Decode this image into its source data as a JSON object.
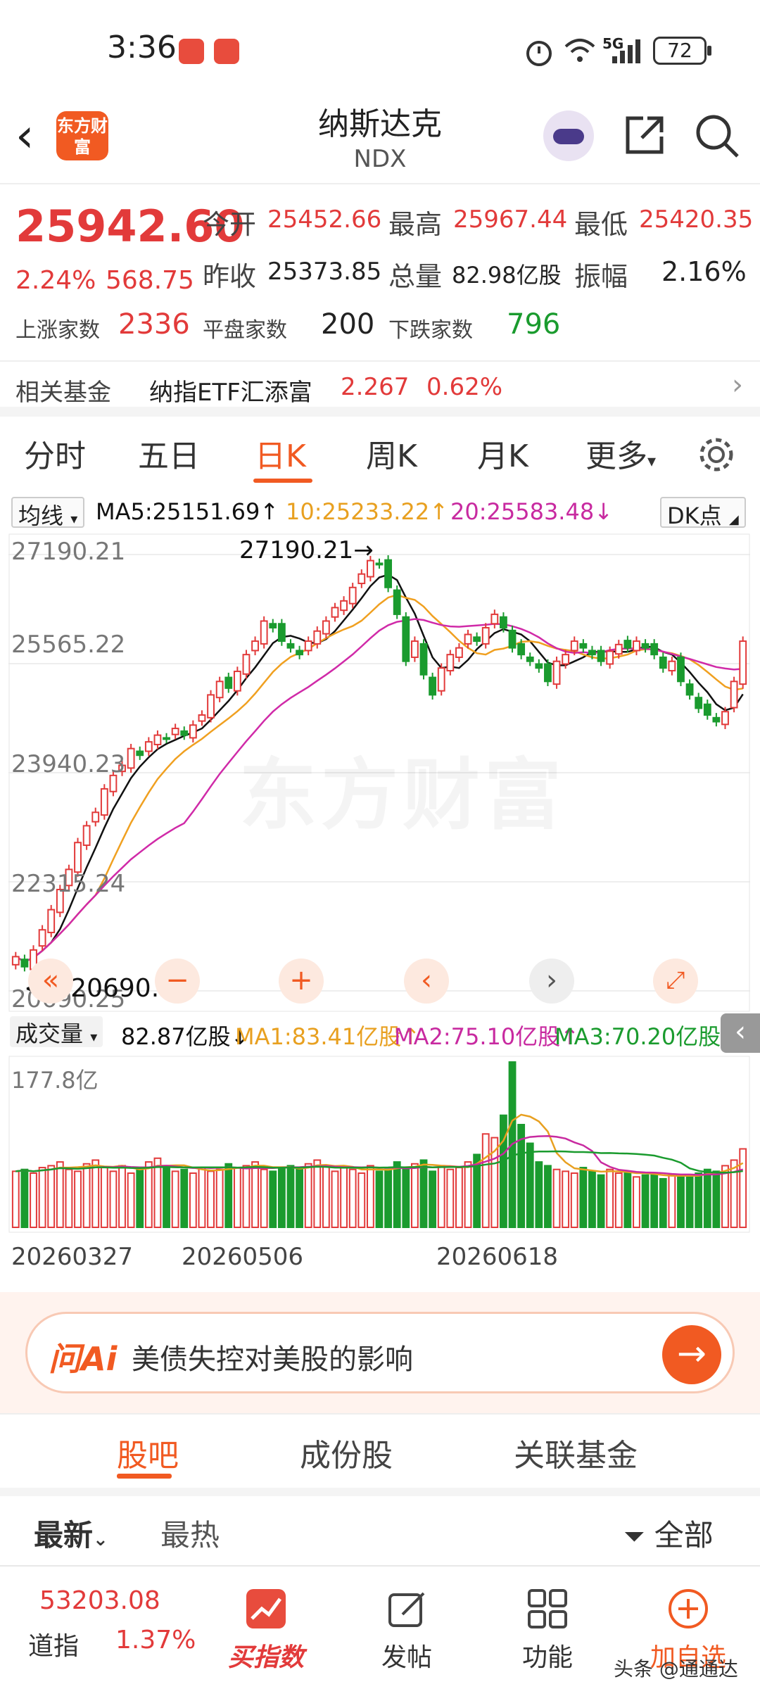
{
  "status_bar": {
    "time": "3:36",
    "network": "5G",
    "battery": "72"
  },
  "header": {
    "title": "纳斯达克",
    "code": "NDX",
    "logo_text": "东方财富"
  },
  "quote": {
    "price": "25942.60",
    "change_pct": "2.24%",
    "change": "568.75",
    "open_label": "今开",
    "open": "25452.66",
    "high_label": "最高",
    "high": "25967.44",
    "low_label": "最低",
    "low": "25420.35",
    "prev_close_label": "昨收",
    "prev_close": "25373.85",
    "volume_label": "总量",
    "volume": "82.98亿股",
    "amplitude_label": "振幅",
    "amplitude": "2.16%",
    "up_label": "上涨家数",
    "up": "2336",
    "flat_label": "平盘家数",
    "flat": "200",
    "down_label": "下跌家数",
    "down": "796"
  },
  "related_fund": {
    "label": "相关基金",
    "name": "纳指ETF汇添富",
    "price": "2.267",
    "change": "0.62%"
  },
  "period_tabs": [
    "分时",
    "五日",
    "日K",
    "周K",
    "月K",
    "更多"
  ],
  "indicators": {
    "selector": "均线",
    "ma5": "MA5:25151.69↑",
    "ma10": "10:25233.22↑",
    "ma20": "20:25583.48↓",
    "dk_button": "DK点"
  },
  "chart_data": {
    "type": "candlestick",
    "y_ticks": [
      "27190.21",
      "25565.22",
      "23940.23",
      "22315.24",
      "20690.25"
    ],
    "ylim": [
      20690.25,
      27190.21
    ],
    "max_marker": "27190.21",
    "min_marker": "20690.25",
    "watermark": "东方财富",
    "x_labels": [
      "20260327",
      "20260506",
      "20260618"
    ],
    "colors": {
      "up": "#e23a3a",
      "down": "#1a9b2e",
      "ma5": "#111111",
      "ma10": "#f0a020",
      "ma20": "#d02aa8"
    },
    "close_series": [
      21200,
      21050,
      21300,
      21600,
      21900,
      22200,
      22500,
      22900,
      23150,
      23350,
      23700,
      23900,
      24050,
      24300,
      24200,
      24400,
      24500,
      24450,
      24600,
      24500,
      24650,
      24800,
      25100,
      25300,
      25200,
      25450,
      25700,
      25900,
      26200,
      26100,
      25900,
      25800,
      25700,
      25900,
      26050,
      26200,
      26400,
      26500,
      26700,
      26900,
      27100,
      27050,
      26700,
      26300,
      25600,
      25900,
      25400,
      25100,
      25500,
      25700,
      25800,
      26000,
      25900,
      26100,
      26300,
      26100,
      25800,
      25700,
      25600,
      25500,
      25300,
      25600,
      25700,
      25900,
      25800,
      25700,
      25600,
      25750,
      25850,
      25800,
      25900,
      25800,
      25700,
      25500,
      25600,
      25300,
      25100,
      24900,
      24800,
      24700,
      24850,
      25300,
      25900
    ]
  },
  "volume": {
    "selector": "成交量",
    "current": "82.87亿股↓",
    "ma1": "MA1:83.41亿股↑",
    "ma2": "MA2:75.10亿股↑",
    "ma3": "MA3:70.20亿股↑",
    "max_label": "177.8亿",
    "bars": [
      60,
      62,
      58,
      64,
      66,
      70,
      62,
      60,
      68,
      72,
      64,
      60,
      66,
      58,
      62,
      70,
      74,
      66,
      60,
      62,
      58,
      64,
      60,
      62,
      68,
      64,
      66,
      70,
      62,
      60,
      64,
      66,
      62,
      68,
      72,
      66,
      60,
      64,
      62,
      58,
      66,
      60,
      62,
      70,
      64,
      68,
      72,
      60,
      66,
      62,
      64,
      70,
      78,
      100,
      96,
      120,
      177,
      110,
      90,
      70,
      66,
      62,
      60,
      58,
      64,
      60,
      56,
      62,
      58,
      60,
      54,
      56,
      58,
      52,
      56,
      54,
      56,
      58,
      62,
      60,
      66,
      72,
      84
    ]
  },
  "ai_bar": {
    "logo": "问Ai",
    "query": "美债失控对美股的影响"
  },
  "sub_tabs": [
    "股吧",
    "成份股",
    "关联基金"
  ],
  "sort": {
    "latest": "最新",
    "hot": "最热",
    "filter": "全部"
  },
  "bottom_bar": {
    "index_value": "53203.08",
    "index_name": "道指",
    "index_change": "1.37%",
    "items": [
      "买指数",
      "发帖",
      "功能",
      "加自选"
    ],
    "watermark": "头条 @通通达"
  }
}
